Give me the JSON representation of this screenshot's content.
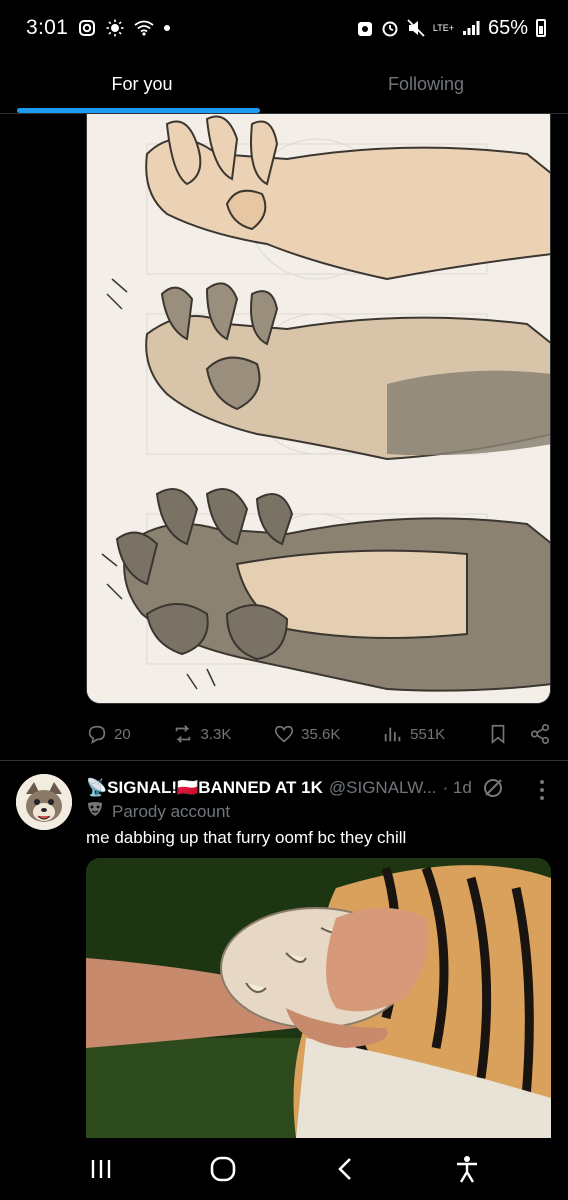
{
  "status_bar": {
    "time": "3:01",
    "network": "LTE+",
    "battery": "65%"
  },
  "tabs": [
    {
      "label": "For you",
      "active": true
    },
    {
      "label": "Following",
      "active": false
    }
  ],
  "post1": {
    "actions": {
      "replies": "20",
      "reposts": "3.3K",
      "likes": "35.6K",
      "views": "551K"
    }
  },
  "post2": {
    "display_name": "📡SIGNAL!🇵🇱BANNED AT 1K",
    "handle": "@SIGNALW...",
    "time": "· 1d",
    "label": "Parody account",
    "text": "me dabbing up that furry oomf bc they chill"
  },
  "colors": {
    "accent": "#1d9bf0",
    "muted": "#71767b",
    "background": "#000000"
  }
}
